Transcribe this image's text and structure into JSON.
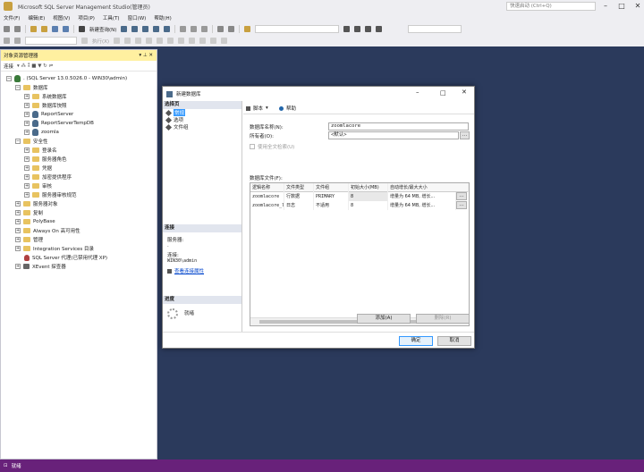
{
  "window": {
    "title": "Microsoft SQL Server Management Studio(管理员)",
    "quick_launch_placeholder": "快速启动 (Ctrl+Q)"
  },
  "menu": [
    "文件(F)",
    "编辑(E)",
    "视图(V)",
    "项目(P)",
    "工具(T)",
    "窗口(W)",
    "帮助(H)"
  ],
  "toolbar": {
    "new_query": "新建查询(N)",
    "execute": "执行(X)"
  },
  "object_explorer": {
    "title": "对象资源管理器",
    "connect": "连接",
    "server": ". (SQL Server 13.0.5026.0 - WIN30\\admin)",
    "items": [
      {
        "label": "数据库"
      },
      {
        "label": "系统数据库"
      },
      {
        "label": "数据库快照"
      },
      {
        "label": "ReportServer"
      },
      {
        "label": "ReportServerTempDB"
      },
      {
        "label": "zoomla"
      },
      {
        "label": "安全性"
      },
      {
        "label": "登录名"
      },
      {
        "label": "服务器角色"
      },
      {
        "label": "凭据"
      },
      {
        "label": "加密提供程序"
      },
      {
        "label": "审核"
      },
      {
        "label": "服务器审核规范"
      },
      {
        "label": "服务器对象"
      },
      {
        "label": "复制"
      },
      {
        "label": "PolyBase"
      },
      {
        "label": "Always On 高可用性"
      },
      {
        "label": "管理"
      },
      {
        "label": "Integration Services 目录"
      },
      {
        "label": "SQL Server 代理(已禁用代理 XP)"
      },
      {
        "label": "XEvent 探查器"
      }
    ]
  },
  "status": {
    "text": "就绪"
  },
  "dialog": {
    "title": "新建数据库",
    "select_page": "选择页",
    "pages": [
      "常规",
      "选项",
      "文件组"
    ],
    "connection_section": "连接",
    "server_label": "服务器:",
    "server_value": ".",
    "connection_label": "连接:",
    "connection_value": "WIN30\\admin",
    "view_conn_props": "查看连接属性",
    "progress_section": "进度",
    "progress_status": "就绪",
    "script_btn": "脚本",
    "help_btn": "帮助",
    "db_name_label": "数据库名称(N):",
    "db_name_value": "zoomlacore",
    "owner_label": "所有者(O):",
    "owner_value": "<默认>",
    "fulltext_label": "使用全文检索(U)",
    "files_label": "数据库文件(F):",
    "columns": [
      "逻辑名称",
      "文件类型",
      "文件组",
      "初始大小(MB)",
      "自动增长/最大大小"
    ],
    "rows": [
      [
        "zoomlacore",
        "行数据",
        "PRIMARY",
        "8",
        "增量为 64 MB, 增长..."
      ],
      [
        "zoomlacore_log",
        "日志",
        "不适用",
        "8",
        "增量为 64 MB, 增长..."
      ]
    ],
    "add_btn": "添加(A)",
    "remove_btn": "删除(R)",
    "ok_btn": "确定",
    "cancel_btn": "取消"
  }
}
